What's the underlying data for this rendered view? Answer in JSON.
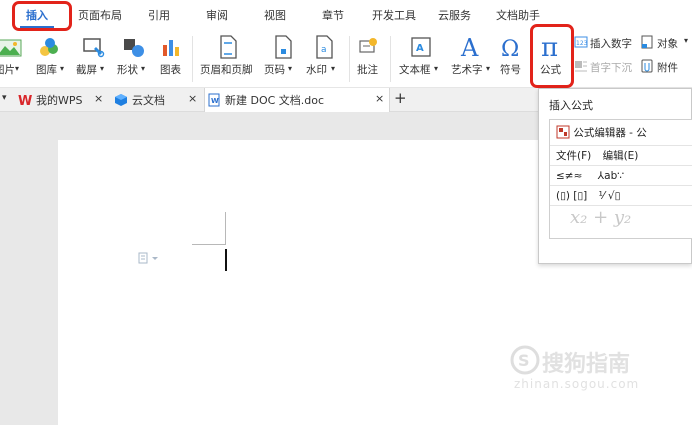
{
  "menu": {
    "tabs": [
      "插入",
      "页面布局",
      "引用",
      "审阅",
      "视图",
      "章节",
      "开发工具",
      "云服务",
      "文档助手"
    ],
    "active_tab": "插入"
  },
  "ribbon": {
    "picture": "图片",
    "gallery": "图库",
    "screenshot": "截屏",
    "shapes": "形状",
    "chart": "图表",
    "header_footer": "页眉和页脚",
    "page_number": "页码",
    "watermark": "水印",
    "comment": "批注",
    "textbox": "文本框",
    "wordart": "艺术字",
    "symbol": "符号",
    "formula": "公式",
    "insert_number": "插入数字",
    "object": "对象",
    "drop_cap": "首字下沉",
    "attachment": "附件",
    "dropdown_arrow": "▾"
  },
  "doc_tabs": {
    "my_wps": "我的WPS",
    "cloud_docs": "云文档",
    "current_doc": "新建 DOC 文档.doc",
    "close_glyph": "×",
    "new_tab": "+"
  },
  "formula_popup": {
    "title": "插入公式",
    "editor_title": "公式编辑器 - 公",
    "menu_file": "文件(F)",
    "menu_edit": "编辑(E)",
    "row_relations": "≤≠≈",
    "row_spacing": "⅄ab∵",
    "row_fences": "(▯) [▯]",
    "row_fractions": "⅟ √▯",
    "preview": "x₂ + y₂"
  },
  "watermark": {
    "brand": "搜狗指南",
    "url": "zhinan.sogou.com"
  },
  "colors": {
    "accent": "#2b6fce",
    "highlight": "#e2231a",
    "wps_red": "#d9262a",
    "cloud_blue": "#1f7fe0"
  }
}
